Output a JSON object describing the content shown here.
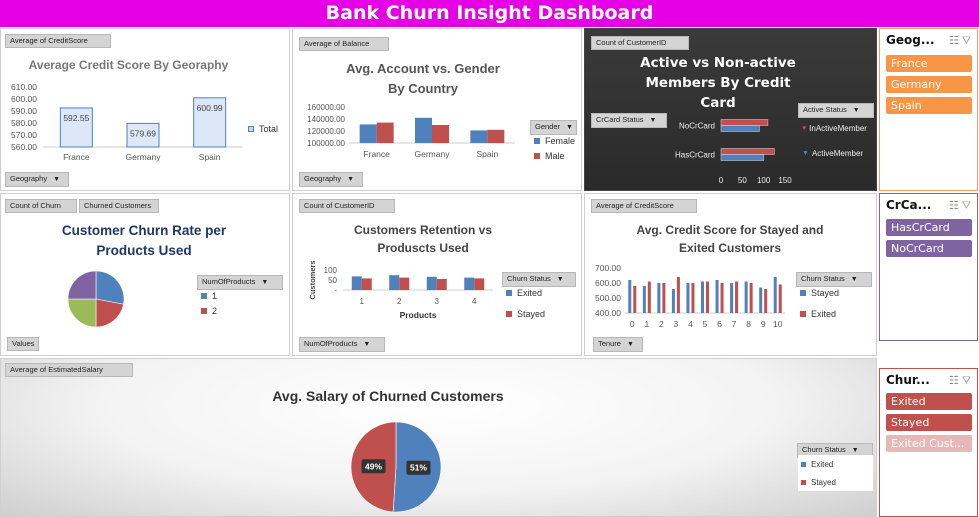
{
  "dashboard": {
    "title": "Bank Churn Insight Dashboard"
  },
  "colors": {
    "banner": "#e600e6",
    "blue": "#4f81bd",
    "red": "#c0504d",
    "green": "#9bbb59",
    "purple": "#8064a2",
    "orange": "#f79646",
    "slicer_purple": "#8064a2",
    "slicer_red": "#c0504d"
  },
  "panels": {
    "credit_geo": {
      "tag": "Average of CreditScore",
      "filter": "Geography",
      "legend": "Total"
    },
    "balance_gender": {
      "tag": "Average of Balance",
      "filter": "Geography",
      "legend_title": "Gender",
      "legend": [
        "Female",
        "Male"
      ]
    },
    "active_members": {
      "tag": "Count of CustomerID",
      "filter": "CrCard Status",
      "legend_title": "Active Status",
      "legend": [
        "InActiveMember",
        "ActiveMember"
      ]
    },
    "churn_rate": {
      "tag1": "Count of Churn",
      "tag2": "Churned Customers",
      "legend_title": "NumOfProducts",
      "legend": [
        "1",
        "2"
      ],
      "footer": "Values"
    },
    "retention": {
      "tag": "Count of CustomerID",
      "filter": "NumOfProducts",
      "legend_title": "Churn Status",
      "legend": [
        "Exited",
        "Stayed"
      ]
    },
    "credit_stayed": {
      "tag": "Average of CreditScore",
      "filter": "Tenure",
      "legend_title": "Churn Status",
      "legend": [
        "Stayed",
        "Exited"
      ]
    },
    "salary": {
      "tag": "Average of EstimatedSalary",
      "legend_title": "Churn Status",
      "legend": [
        "Exited",
        "Stayed"
      ]
    }
  },
  "slicers": {
    "geography": {
      "header": "Geog...",
      "items": [
        "France",
        "Germany",
        "Spain"
      ]
    },
    "crcard": {
      "header": "CrCa...",
      "items": [
        "HasCrCard",
        "NoCrCard"
      ]
    },
    "churn": {
      "header": "Chur...",
      "items": [
        "Exited",
        "Stayed",
        "Exited Cust..."
      ]
    }
  },
  "chart_data": [
    {
      "id": "credit_geo",
      "type": "bar",
      "title": "Average Credit Score By Georaphy",
      "categories": [
        "France",
        "Germany",
        "Spain"
      ],
      "series": [
        {
          "name": "Total",
          "values": [
            592.55,
            579.69,
            600.99
          ]
        }
      ],
      "ylim": [
        560,
        610
      ],
      "yticks": [
        "610.00",
        "600.00",
        "590.00",
        "580.00",
        "570.00",
        "560.00"
      ],
      "data_labels": [
        "592.55",
        "579.69",
        "600.99"
      ]
    },
    {
      "id": "balance_gender",
      "type": "bar",
      "title": "Avg. Account vs. Gender By Country",
      "categories": [
        "France",
        "Germany",
        "Spain"
      ],
      "series": [
        {
          "name": "Female",
          "values": [
            131000,
            142000,
            121000
          ]
        },
        {
          "name": "Male",
          "values": [
            134000,
            130000,
            122000
          ]
        }
      ],
      "ylim": [
        100000,
        160000
      ],
      "yticks": [
        "160000.00",
        "140000.00",
        "120000.00",
        "100000.00"
      ]
    },
    {
      "id": "active_members",
      "type": "bar",
      "orientation": "horizontal",
      "title": "Active vs Non-active Members By Credit Card",
      "categories": [
        "NoCrCard",
        "HasCrCard"
      ],
      "series": [
        {
          "name": "InActiveMember",
          "values": [
            110,
            125
          ]
        },
        {
          "name": "ActiveMember",
          "values": [
            90,
            100
          ]
        }
      ],
      "xlim": [
        0,
        150
      ],
      "xticks": [
        "0",
        "50",
        "100",
        "150"
      ]
    },
    {
      "id": "churn_rate",
      "type": "pie",
      "title": "Customer Churn Rate per Products Used",
      "slices": [
        {
          "value": 28,
          "color": "#4f81bd"
        },
        {
          "value": 22,
          "color": "#c0504d"
        },
        {
          "value": 25,
          "color": "#9bbb59"
        },
        {
          "value": 25,
          "color": "#8064a2"
        }
      ]
    },
    {
      "id": "retention",
      "type": "bar",
      "title": "Customers Retention vs Produscts Used",
      "xlabel": "Products",
      "ylabel": "Customers",
      "categories": [
        "1",
        "2",
        "3",
        "4"
      ],
      "series": [
        {
          "name": "Exited",
          "values": [
            68,
            74,
            66,
            62
          ]
        },
        {
          "name": "Stayed",
          "values": [
            58,
            62,
            55,
            58
          ]
        }
      ],
      "ylim": [
        0,
        100
      ],
      "yticks": [
        "100",
        "50",
        "-"
      ]
    },
    {
      "id": "credit_stayed",
      "type": "bar",
      "title": "Avg. Credit Score for Stayed and Exited Customers",
      "categories": [
        "0",
        "1",
        "2",
        "3",
        "4",
        "5",
        "6",
        "7",
        "8",
        "9",
        "10"
      ],
      "series": [
        {
          "name": "Stayed",
          "values": [
            620,
            580,
            600,
            560,
            600,
            610,
            620,
            600,
            610,
            570,
            640
          ]
        },
        {
          "name": "Exited",
          "values": [
            580,
            610,
            600,
            640,
            600,
            610,
            600,
            610,
            600,
            560,
            590
          ]
        }
      ],
      "ylim": [
        400,
        700
      ],
      "yticks": [
        "700.00",
        "600.00",
        "500.00",
        "400.00"
      ]
    },
    {
      "id": "salary",
      "type": "pie",
      "title": "Avg. Salary of Churned Customers",
      "slices": [
        {
          "name": "Stayed",
          "value": 51,
          "label": "51%",
          "color": "#4f81bd"
        },
        {
          "name": "Exited",
          "value": 49,
          "label": "49%",
          "color": "#c0504d"
        }
      ]
    }
  ]
}
